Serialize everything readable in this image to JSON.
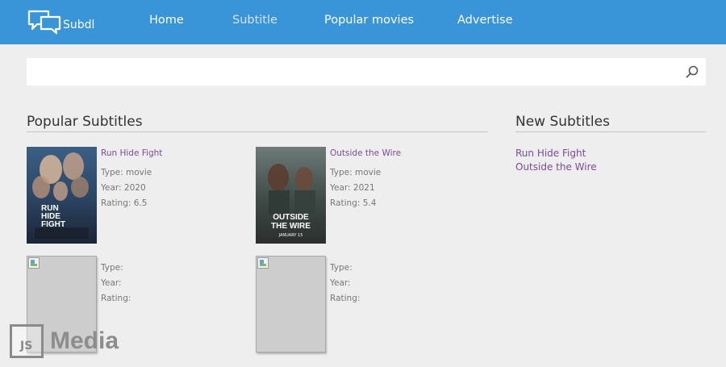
{
  "brand": {
    "name": "Subdl"
  },
  "nav": {
    "home": "Home",
    "subtitle": "Subtitle",
    "popular_movies": "Popular movies",
    "advertise": "Advertise"
  },
  "search": {
    "value": "",
    "placeholder": ""
  },
  "popular": {
    "title": "Popular Subtitles",
    "items": [
      {
        "title": "Run Hide Fight",
        "type": "Type: movie",
        "year": "Year: 2020",
        "rating": "Rating: 6.5",
        "poster_text": "RUN HIDE FIGHT"
      },
      {
        "title": "Outside the Wire",
        "type": "Type: movie",
        "year": "Year: 2021",
        "rating": "Rating: 5.4",
        "poster_text": "OUTSIDE THE WIRE",
        "poster_date": "JANUARY 15"
      },
      {
        "title": "",
        "type": "Type:",
        "year": "Year:",
        "rating": "Rating:"
      },
      {
        "title": "",
        "type": "Type:",
        "year": "Year:",
        "rating": "Rating:"
      }
    ]
  },
  "new_subtitles": {
    "title": "New Subtitles",
    "links": [
      "Run Hide Fight",
      "Outside the Wire"
    ]
  },
  "watermark": {
    "logo": "JS",
    "text": "Media"
  },
  "colors": {
    "navbar": "#3a95d8",
    "link": "#7b4a9c",
    "background": "#eeeeee"
  }
}
